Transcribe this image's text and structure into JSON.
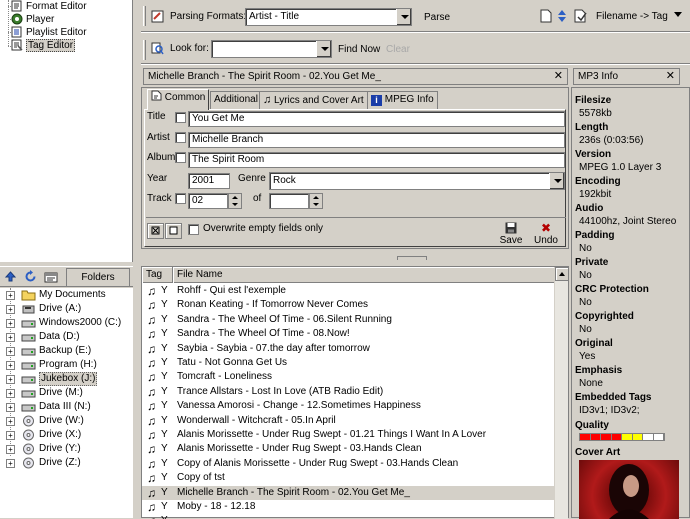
{
  "nav": {
    "items": [
      {
        "label": "Format Editor",
        "icon": "format-editor-icon"
      },
      {
        "label": "Player",
        "icon": "player-icon"
      },
      {
        "label": "Playlist Editor",
        "icon": "playlist-editor-icon"
      },
      {
        "label": "Tag Editor",
        "icon": "tag-editor-icon",
        "selected": true
      }
    ]
  },
  "folders": {
    "tab_label": "Folders",
    "items": [
      {
        "label": "My Documents",
        "icon": "folder-icon"
      },
      {
        "label": "Drive (A:)",
        "icon": "floppy-drive-icon"
      },
      {
        "label": "Windows2000 (C:)",
        "icon": "hard-drive-icon"
      },
      {
        "label": "Data (D:)",
        "icon": "hard-drive-icon"
      },
      {
        "label": "Backup (E:)",
        "icon": "hard-drive-icon"
      },
      {
        "label": "Program (H:)",
        "icon": "hard-drive-icon"
      },
      {
        "label": "Jukebox (J:)",
        "icon": "hard-drive-icon",
        "selected": true
      },
      {
        "label": "Drive (M:)",
        "icon": "hard-drive-icon"
      },
      {
        "label": "Data III (N:)",
        "icon": "hard-drive-icon"
      },
      {
        "label": "Drive (W:)",
        "icon": "cd-drive-icon"
      },
      {
        "label": "Drive (X:)",
        "icon": "cd-drive-icon"
      },
      {
        "label": "Drive (Y:)",
        "icon": "cd-drive-icon"
      },
      {
        "label": "Drive (Z:)",
        "icon": "cd-drive-icon"
      }
    ]
  },
  "parse_bar": {
    "label": "Parsing Formats:",
    "format_value": "Artist - Title",
    "parse_label": "Parse",
    "filename_tag_label": "Filename -> Tag"
  },
  "search_bar": {
    "label": "Look for:",
    "value": "",
    "find_now": "Find Now",
    "clear": "Clear"
  },
  "tag_editor": {
    "header": "Michelle Branch - The Spirit Room - 02.You Get Me_",
    "tabs": [
      "Common",
      "Additional",
      "Lyrics and Cover Art",
      "MPEG Info"
    ],
    "active_tab": "Common",
    "fields": {
      "title_label": "Title",
      "title": "You Get Me",
      "artist_label": "Artist",
      "artist": "Michelle Branch",
      "album_label": "Album",
      "album": "The Spirit Room",
      "year_label": "Year",
      "year": "2001",
      "genre_label": "Genre",
      "genre": "Rock",
      "track_label": "Track",
      "track": "02",
      "of_label": "of",
      "of_value": ""
    },
    "overwrite_label": "Overwrite empty fields only",
    "save_label": "Save",
    "undo_label": "Undo"
  },
  "file_list": {
    "columns": [
      "Tag",
      "File Name"
    ],
    "rows": [
      {
        "tag": "Y",
        "name": "Rohff - Qui est l'exemple"
      },
      {
        "tag": "Y",
        "name": "Ronan Keating - If Tomorrow Never Comes"
      },
      {
        "tag": "Y",
        "name": "Sandra - The Wheel Of Time - 06.Silent Running"
      },
      {
        "tag": "Y",
        "name": "Sandra - The Wheel Of Time - 08.Now!"
      },
      {
        "tag": "Y",
        "name": "Saybia - Saybia - 07.the day after tomorrow"
      },
      {
        "tag": "Y",
        "name": "Tatu - Not Gonna Get Us"
      },
      {
        "tag": "Y",
        "name": "Tomcraft - Loneliness"
      },
      {
        "tag": "Y",
        "name": "Trance Allstars - Lost In Love (ATB Radio Edit)"
      },
      {
        "tag": "Y",
        "name": "Vanessa Amorosi - Change  - 12.Sometimes Happiness"
      },
      {
        "tag": "Y",
        "name": "Wonderwall - Witchcraft - 05.In April"
      },
      {
        "tag": "Y",
        "name": "Alanis Morissette - Under Rug Swept - 01.21 Things I Want In A Lover"
      },
      {
        "tag": "Y",
        "name": "Alanis Morissette - Under Rug Swept - 03.Hands Clean"
      },
      {
        "tag": "Y",
        "name": "Copy of Alanis Morissette - Under Rug Swept - 03.Hands Clean"
      },
      {
        "tag": "Y",
        "name": "Copy of tst"
      },
      {
        "tag": "Y",
        "name": "Michelle Branch - The Spirit Room - 02.You Get Me_",
        "selected": true
      },
      {
        "tag": "Y",
        "name": "Moby - 18 - 12.18"
      },
      {
        "tag": "Y",
        "name": ""
      }
    ]
  },
  "mp3_info": {
    "header": "MP3 Info",
    "entries": [
      {
        "key": "Filesize",
        "value": "5578kb"
      },
      {
        "key": "Length",
        "value": "236s (0:03:56)"
      },
      {
        "key": "Version",
        "value": "MPEG 1.0 Layer 3"
      },
      {
        "key": "Encoding",
        "value": "192kbit"
      },
      {
        "key": "Audio",
        "value": "44100hz, Joint Stereo"
      },
      {
        "key": "Padding",
        "value": "No"
      },
      {
        "key": "Private",
        "value": "No"
      },
      {
        "key": "CRC Protection",
        "value": "No"
      },
      {
        "key": "Copyrighted",
        "value": "No"
      },
      {
        "key": "Original",
        "value": "Yes"
      },
      {
        "key": "Emphasis",
        "value": "None"
      },
      {
        "key": "Embedded Tags",
        "value": "ID3v1; ID3v2;"
      }
    ],
    "quality_label": "Quality",
    "quality_colors": [
      "#ff0000",
      "#ff0000",
      "#ff0000",
      "#ff0000",
      "#ffff00",
      "#ffff00",
      "#ffffff",
      "#ffffff"
    ],
    "cover_label": "Cover Art"
  },
  "colors": {
    "face": "#d4d0c8",
    "window": "#ffffff",
    "shadow": "#808080"
  }
}
